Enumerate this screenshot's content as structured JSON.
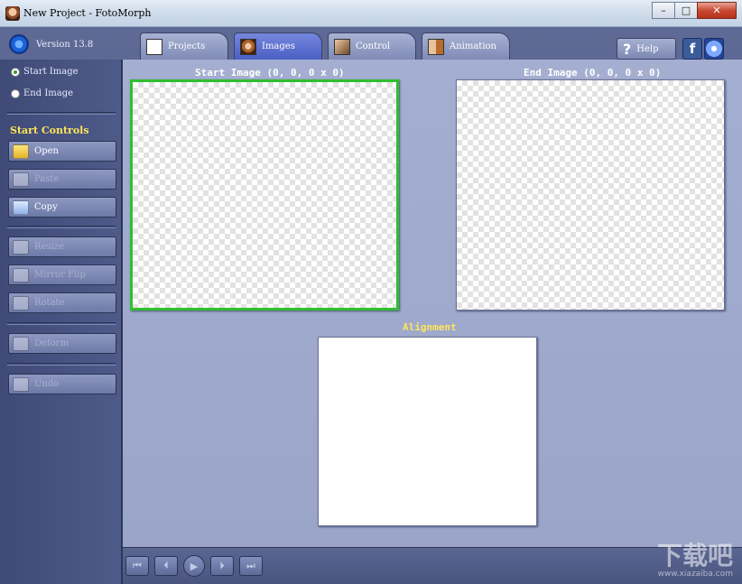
{
  "window": {
    "title": "New Project - FotoMorph",
    "minimize": "–",
    "maximize": "□",
    "close": "✕"
  },
  "header": {
    "version": "Version 13.8",
    "tabs": [
      {
        "label": "Projects",
        "icon": "grid-icon"
      },
      {
        "label": "Images",
        "icon": "face-icon",
        "active": true
      },
      {
        "label": "Control",
        "icon": "control-icon"
      },
      {
        "label": "Animation",
        "icon": "animation-icon"
      }
    ],
    "help_label": "Help",
    "help_glyph": "?",
    "facebook_glyph": "f"
  },
  "sidebar": {
    "radio_start": "Start Image",
    "radio_end": "End Image",
    "section_title": "Start Controls",
    "buttons": {
      "open": "Open",
      "paste": "Paste",
      "copy": "Copy",
      "resize": "Resize",
      "mirror_flip": "Mirror Flip",
      "rotate": "Rotate",
      "deform": "Deform",
      "undo": "Undo"
    }
  },
  "workspace": {
    "start_label": "Start Image (0, 0, 0 x 0)",
    "end_label": "End Image (0, 0, 0 x 0)",
    "alignment_label": "Alignment"
  },
  "transport": {
    "first": "⏮",
    "prev": "⏴",
    "play": "▶",
    "next": "⏵",
    "last": "⏭"
  },
  "watermark": {
    "main": "下载吧",
    "sub": "www.xiazaiba.com"
  },
  "colors": {
    "accent_yellow": "#ffe45a",
    "active_border_green": "#2fbf2f",
    "panel_blue": "#4e5a88"
  }
}
